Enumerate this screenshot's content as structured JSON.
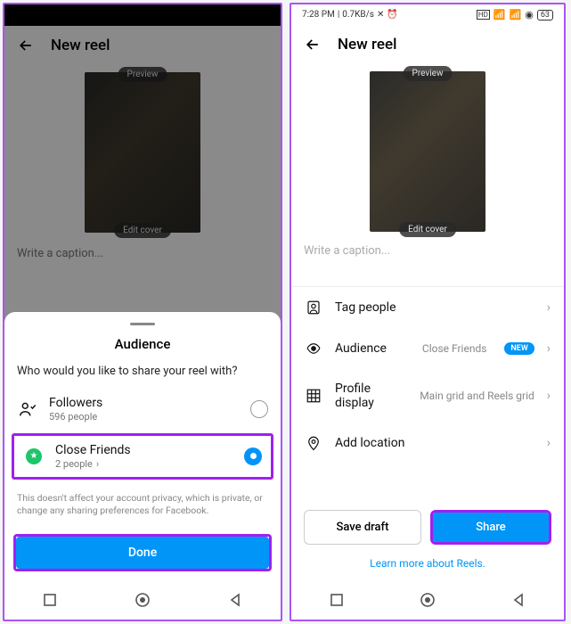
{
  "left": {
    "header_title": "New reel",
    "preview_label": "Preview",
    "edit_cover_label": "Edit cover",
    "caption_placeholder": "Write a caption...",
    "sheet": {
      "title": "Audience",
      "question": "Who would you like to share your reel with?",
      "followers": {
        "label": "Followers",
        "sub": "596 people"
      },
      "close_friends": {
        "label": "Close Friends",
        "sub": "2 people"
      },
      "disclaimer": "This doesn't affect your account privacy, which is private, or change any sharing preferences for Facebook.",
      "done": "Done"
    }
  },
  "right": {
    "status": {
      "time": "7:28 PM",
      "speed": "0.7KB/s",
      "battery": "63"
    },
    "header_title": "New reel",
    "preview_label": "Preview",
    "edit_cover_label": "Edit cover",
    "caption_placeholder": "Write a caption...",
    "rows": {
      "tag_people": "Tag people",
      "audience": "Audience",
      "audience_value": "Close Friends",
      "audience_badge": "NEW",
      "profile_display": "Profile display",
      "profile_display_value": "Main grid and Reels grid",
      "add_location": "Add location"
    },
    "buttons": {
      "save_draft": "Save draft",
      "share": "Share"
    },
    "learn_more": "Learn more about Reels."
  }
}
